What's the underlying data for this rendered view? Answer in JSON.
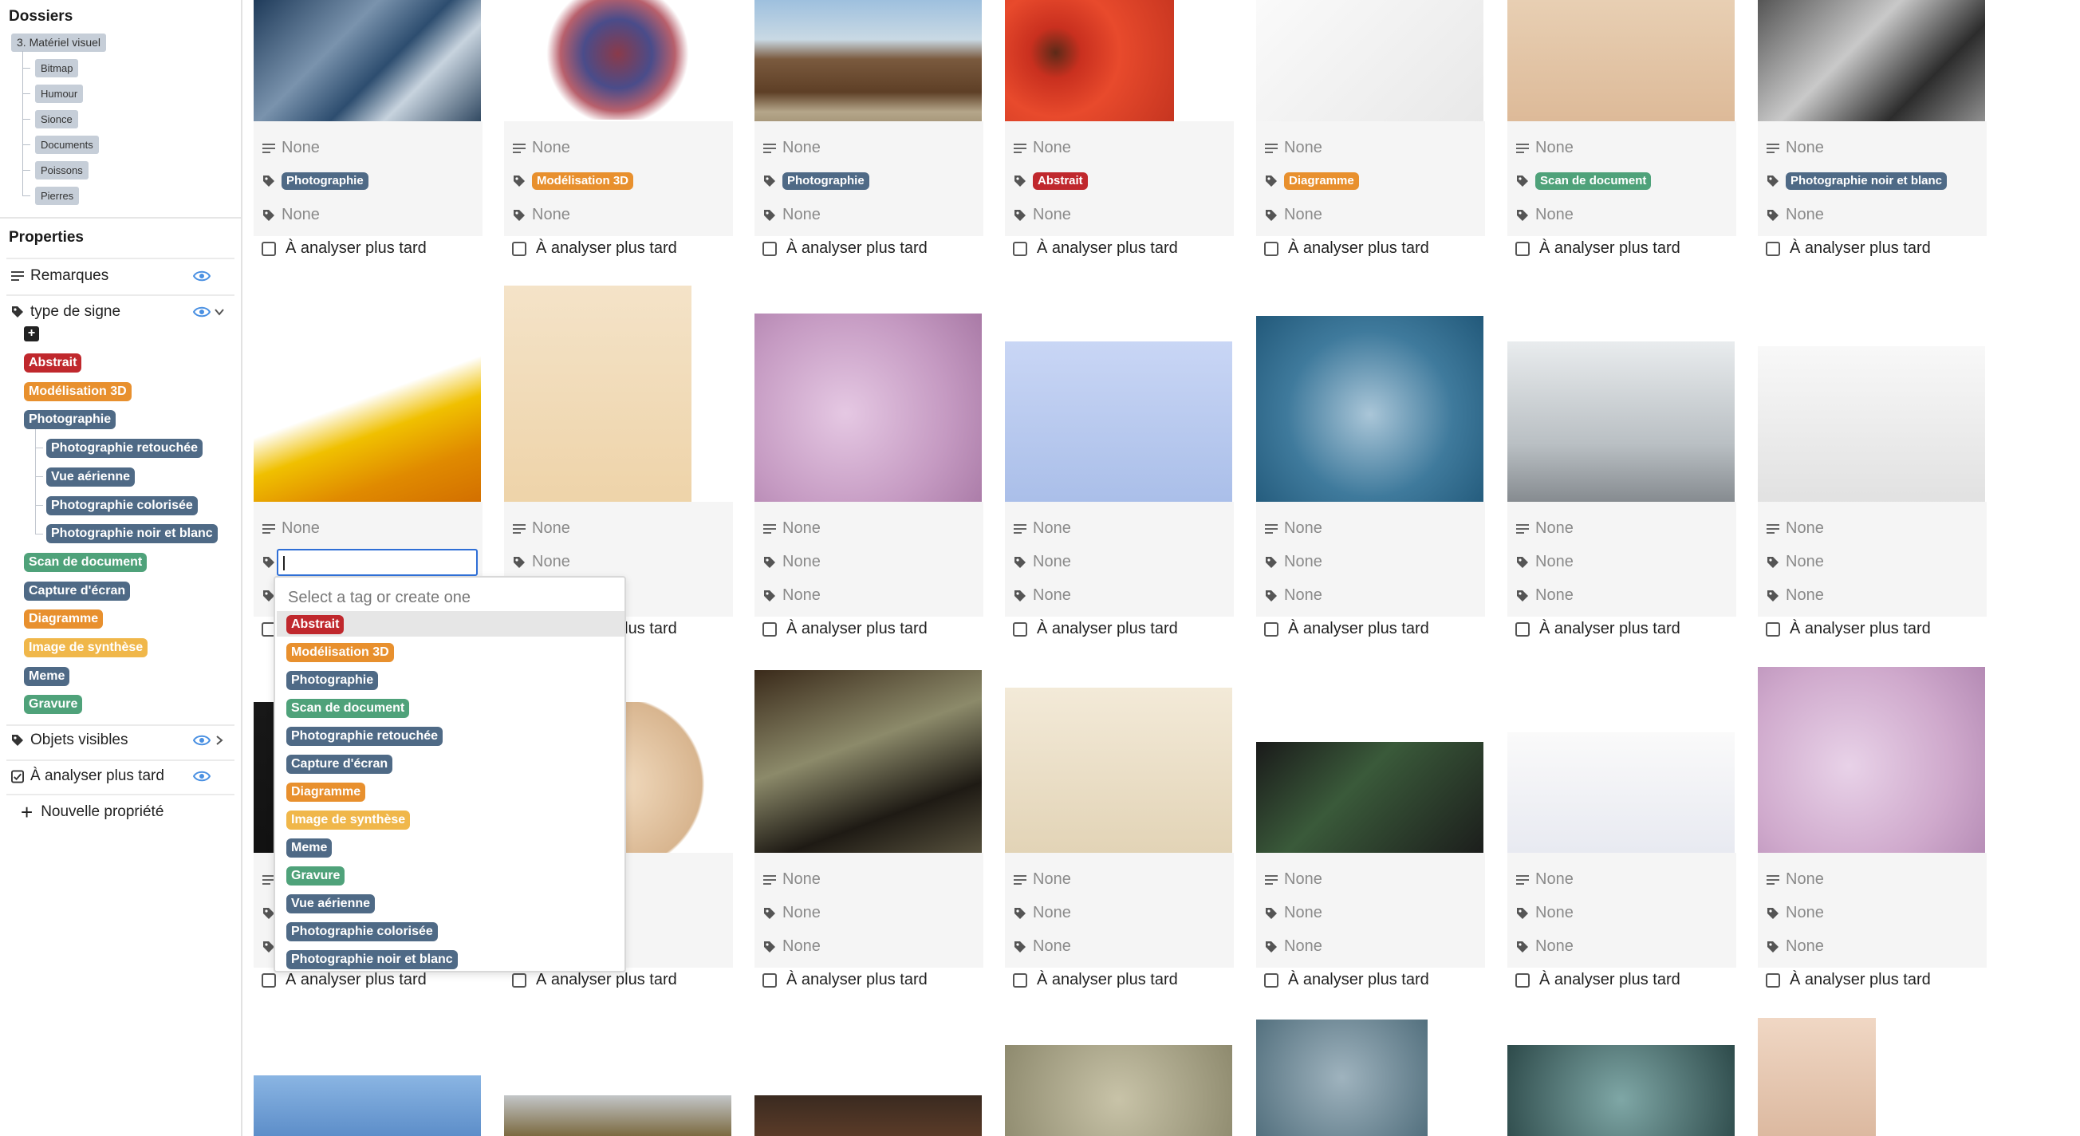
{
  "sidebar": {
    "folders_title": "Dossiers",
    "folders": [
      {
        "label": "3. Matériel visuel"
      },
      {
        "label": "Bitmap"
      },
      {
        "label": "Humour"
      },
      {
        "label": "Sionce"
      },
      {
        "label": "Documents"
      },
      {
        "label": "Poissons"
      },
      {
        "label": "Pierres"
      }
    ],
    "properties_title": "Properties",
    "properties": [
      {
        "label": "Remarques",
        "icon": "lines-icon"
      },
      {
        "label": "type de signe",
        "icon": "tag-icon"
      },
      {
        "label": "Objets visibles",
        "icon": "tag-icon"
      },
      {
        "label": "À analyser plus tard",
        "icon": "checkbox-icon"
      }
    ],
    "tag_tree": [
      {
        "label": "Abstrait",
        "color": "#c0282d"
      },
      {
        "label": "Modélisation 3D",
        "color": "#e8902e"
      },
      {
        "label": "Photographie",
        "color": "#4f6a86"
      },
      {
        "label": "Photographie retouchée",
        "color": "#4f6a86"
      },
      {
        "label": "Vue aérienne",
        "color": "#4f6a86"
      },
      {
        "label": "Photographie colorisée",
        "color": "#4f6a86"
      },
      {
        "label": "Photographie noir et blanc",
        "color": "#4f6a86"
      },
      {
        "label": "Scan de document",
        "color": "#4fa27a"
      },
      {
        "label": "Capture d'écran",
        "color": "#4f6a86"
      },
      {
        "label": "Diagramme",
        "color": "#e8902e"
      },
      {
        "label": "Image de synthèse",
        "color": "#f0b74a"
      },
      {
        "label": "Meme",
        "color": "#4f6a86"
      },
      {
        "label": "Gravure",
        "color": "#4fa27a"
      }
    ],
    "new_property": "Nouvelle propriété"
  },
  "grid": {
    "none": "None",
    "later": "À analyser plus tard",
    "row1_tags": [
      {
        "label": "Photographie",
        "color": "#4f6a86"
      },
      {
        "label": "Modélisation 3D",
        "color": "#e8902e"
      },
      {
        "label": "Photographie",
        "color": "#4f6a86"
      },
      {
        "label": "Abstrait",
        "color": "#c0282d"
      },
      {
        "label": "Diagramme",
        "color": "#e8902e"
      },
      {
        "label": "Scan de document",
        "color": "#4fa27a"
      },
      {
        "label": "Photographie noir et blanc",
        "color": "#4f6a86"
      }
    ]
  },
  "dropdown": {
    "placeholder": "Select a tag or create one",
    "options": [
      {
        "label": "Abstrait",
        "color": "#c0282d"
      },
      {
        "label": "Modélisation 3D",
        "color": "#e8902e"
      },
      {
        "label": "Photographie",
        "color": "#4f6a86"
      },
      {
        "label": "Scan de document",
        "color": "#4fa27a"
      },
      {
        "label": "Photographie retouchée",
        "color": "#4f6a86"
      },
      {
        "label": "Capture d'écran",
        "color": "#4f6a86"
      },
      {
        "label": "Diagramme",
        "color": "#e8902e"
      },
      {
        "label": "Image de synthèse",
        "color": "#f0b74a"
      },
      {
        "label": "Meme",
        "color": "#4f6a86"
      },
      {
        "label": "Gravure",
        "color": "#4fa27a"
      },
      {
        "label": "Vue aérienne",
        "color": "#4f6a86"
      },
      {
        "label": "Photographie colorisée",
        "color": "#4f6a86"
      },
      {
        "label": "Photographie noir et blanc",
        "color": "#4f6a86"
      }
    ]
  }
}
